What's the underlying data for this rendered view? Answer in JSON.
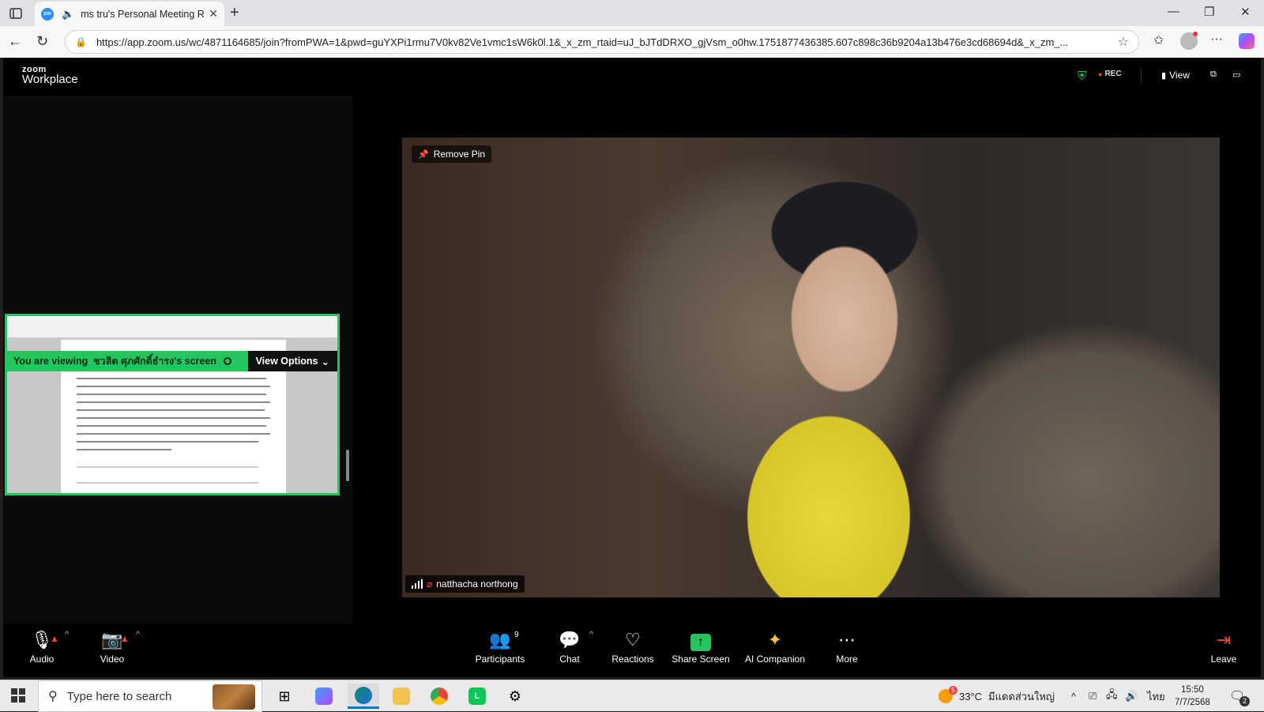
{
  "browser": {
    "tab": {
      "favicon": "zm",
      "title": "ms tru's Personal Meeting Ro",
      "audio_icon": "speaker-icon"
    },
    "new_tab_symbol": "+",
    "window": {
      "minimize": "—",
      "restore": "❐",
      "close": "✕"
    },
    "url": "https://app.zoom.us/wc/4871164685/join?fromPWA=1&pwd=guYXPi1rmu7V0kv82Ve1vmc1sW6k0l.1&_x_zm_rtaid=uJ_bJTdDRXO_gjVsm_o0hw.1751877436385.607c898c36b9204a13b476e3cd68694d&_x_zm_..."
  },
  "zoom": {
    "brand_small": "zoom",
    "brand_big": "Workplace",
    "rec_label": "REC",
    "view_label": "View",
    "share_banner": {
      "you_are_viewing": "You are viewing",
      "presenter_screen": "ชวลิต ศุภศักดิ์ธำรง's screen",
      "view_options": "View Options"
    },
    "video": {
      "remove_pin": "Remove Pin",
      "participant_name": "natthacha northong"
    },
    "toolbar": {
      "audio": "Audio",
      "video": "Video",
      "participants": "Participants",
      "participants_count": "9",
      "chat": "Chat",
      "reactions": "Reactions",
      "share_screen": "Share Screen",
      "ai_companion": "AI Companion",
      "more": "More",
      "leave": "Leave"
    },
    "colors": {
      "accent_green": "#22c55e",
      "alert_red": "#ef4444",
      "ai_yellow": "#f5c542"
    }
  },
  "taskbar": {
    "search_placeholder": "Type here to search",
    "weather_badge": "5",
    "temperature": "33°C",
    "weather_text": "มีแดดส่วนใหญ่",
    "language": "ไทย",
    "time": "15:50",
    "date": "7/7/2568",
    "notification_count": "2"
  }
}
